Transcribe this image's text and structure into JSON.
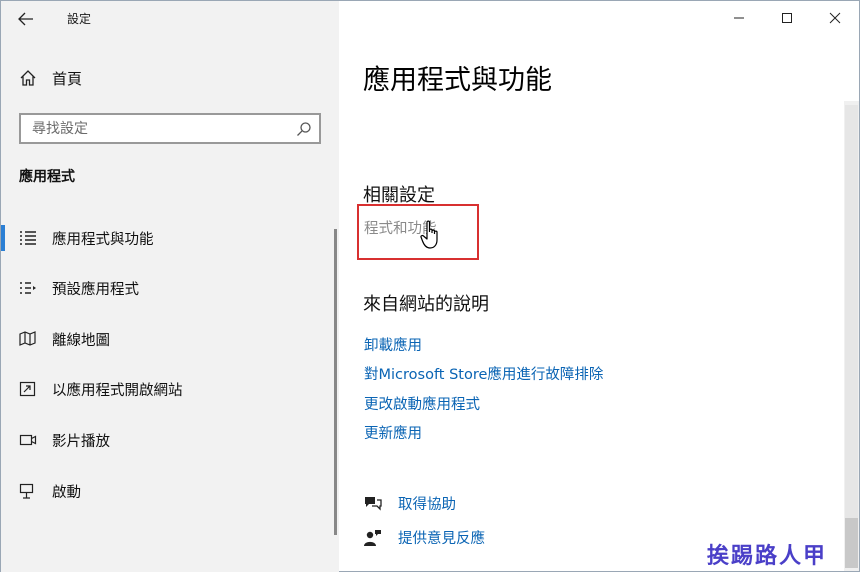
{
  "window": {
    "title": "設定"
  },
  "sidebar": {
    "home_label": "首頁",
    "search_placeholder": "尋找設定",
    "section_heading": "應用程式",
    "items": [
      {
        "label": "應用程式與功能",
        "icon": "apps-features-icon",
        "selected": true
      },
      {
        "label": "預設應用程式",
        "icon": "default-apps-icon",
        "selected": false
      },
      {
        "label": "離線地圖",
        "icon": "offline-maps-icon",
        "selected": false
      },
      {
        "label": "以應用程式開啟網站",
        "icon": "apps-for-websites-icon",
        "selected": false
      },
      {
        "label": "影片播放",
        "icon": "video-playback-icon",
        "selected": false
      },
      {
        "label": "啟動",
        "icon": "startup-icon",
        "selected": false
      }
    ]
  },
  "main": {
    "title": "應用程式與功能",
    "related_settings": {
      "heading": "相關設定",
      "link": "程式和功能"
    },
    "help": {
      "heading": "來自網站的說明",
      "links": [
        "卸載應用",
        "對Microsoft Store應用進行故障排除",
        "更改啟動應用程式",
        "更新應用"
      ]
    },
    "support": [
      {
        "label": "取得協助",
        "icon": "get-help-icon"
      },
      {
        "label": "提供意見反應",
        "icon": "feedback-icon"
      }
    ]
  },
  "watermark": "挨踢路人甲",
  "colors": {
    "accent": "#2b7fd4",
    "link": "#0a64b4",
    "highlight_border": "#d83030",
    "sidebar_bg": "#f2f2f2"
  }
}
